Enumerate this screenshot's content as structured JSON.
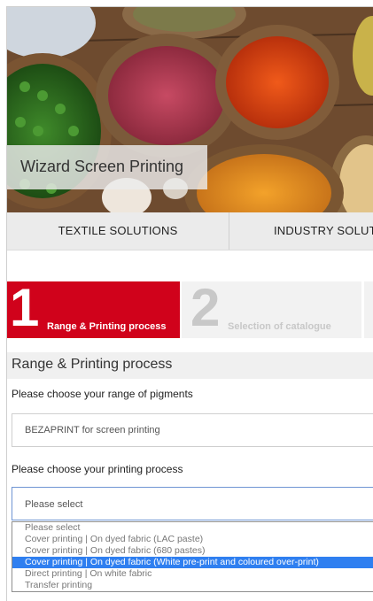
{
  "hero": {
    "title": "Wizard Screen Printing"
  },
  "tabs": [
    {
      "label": "TEXTILE SOLUTIONS"
    },
    {
      "label": "INDUSTRY SOLUT"
    }
  ],
  "steps": [
    {
      "number": "1",
      "label": "Range & Printing process",
      "active": true
    },
    {
      "number": "2",
      "label": "Selection of catalogue",
      "active": false
    }
  ],
  "section": {
    "title": "Range & Printing process"
  },
  "range": {
    "label": "Please choose your range of pigments",
    "value": "BEZAPRINT for screen printing"
  },
  "process": {
    "label": "Please choose your printing process",
    "value": "Please select",
    "options": [
      {
        "label": "Please select",
        "selected": false
      },
      {
        "label": "Cover printing | On dyed fabric (LAC paste)",
        "selected": false
      },
      {
        "label": "Cover printing | On dyed fabric (680 pastes)",
        "selected": false
      },
      {
        "label": "Cover printing | On dyed fabric (White pre-print and coloured over-print)",
        "selected": true
      },
      {
        "label": "Direct printing | On white fabric",
        "selected": false
      },
      {
        "label": "Transfer printing",
        "selected": false
      }
    ]
  },
  "colors": {
    "accent": "#d0021b",
    "highlight": "#2f7ff0",
    "inactive_step": "#c8c8c8"
  }
}
